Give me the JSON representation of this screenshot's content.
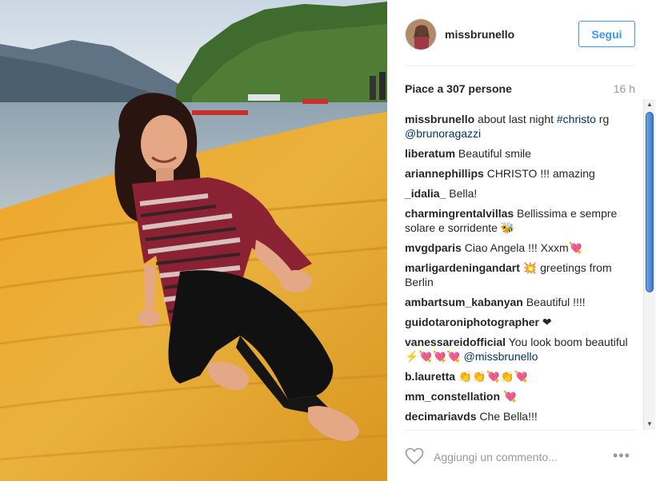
{
  "post": {
    "image_alt": "Woman sitting on orange floating pier fabric by a lake",
    "author": "missbrunello",
    "follow_label": "Segui",
    "likes": "Piace a 307 persone",
    "time": "16 h"
  },
  "comments": [
    {
      "user": "missbrunello",
      "text": " about last night ",
      "link1": "#christo",
      "text2": " rg ",
      "link2": "@brunoragazzi"
    },
    {
      "user": "liberatum",
      "text": " Beautiful smile"
    },
    {
      "user": "ariannephillips",
      "text": " CHRISTO !!! amazing"
    },
    {
      "user": "_idalia_",
      "text": " Bella!"
    },
    {
      "user": "charmingrentalvillas",
      "text": " Bellissima e sempre solare e sorridente 🐝"
    },
    {
      "user": "mvgdparis",
      "text": " Ciao Angela !!! Xxxm💘"
    },
    {
      "user": "marligardeningandart",
      "text": " 💥 greetings from Berlin"
    },
    {
      "user": "ambartsum_kabanyan",
      "text": " Beautiful !!!!"
    },
    {
      "user": "guidotaroniphotographer",
      "text": " ❤"
    },
    {
      "user": "vanessareidofficial",
      "text": " You look boom beautiful ⚡💘💘💘 ",
      "link1": "@missbrunello"
    },
    {
      "user": "b.lauretta",
      "text": " 👏👏💘👏💘"
    },
    {
      "user": "mm_constellation",
      "text": " 💘"
    },
    {
      "user": "decimariavds",
      "text": " Che Bella!!!"
    }
  ],
  "footer": {
    "comment_placeholder": "Aggiungi un commento...",
    "more_label": "•••"
  },
  "colors": {
    "accent": "#3897f0",
    "link": "#003569",
    "muted": "#999999",
    "text": "#262626"
  },
  "icons": {
    "like": "heart-outline-icon",
    "options": "more-options-icon"
  }
}
